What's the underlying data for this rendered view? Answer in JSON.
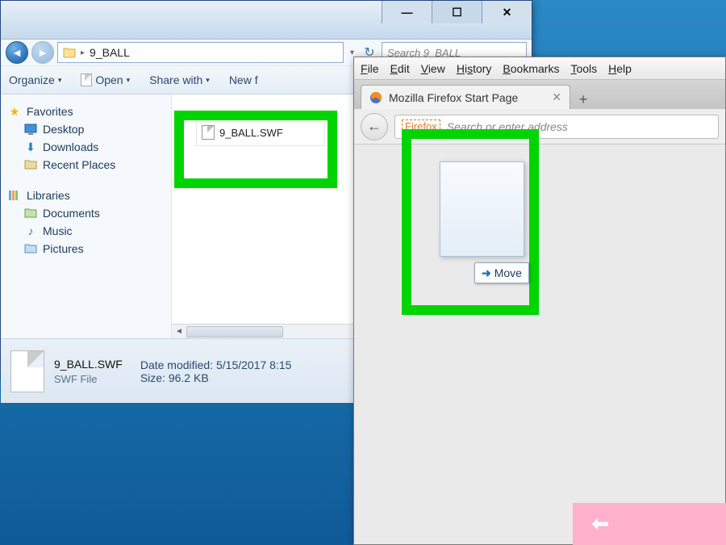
{
  "desktop": {
    "folder_icon": "folder-icon"
  },
  "explorer": {
    "path": "9_BALL",
    "search_placeholder": "Search 9_BALL",
    "toolbar": {
      "organize": "Organize",
      "open": "Open",
      "share": "Share with",
      "newf": "New f"
    },
    "sidebar": {
      "favorites": "Favorites",
      "desktop": "Desktop",
      "downloads": "Downloads",
      "recent": "Recent Places",
      "libraries": "Libraries",
      "documents": "Documents",
      "music": "Music",
      "pictures": "Pictures"
    },
    "file": {
      "name": "9_BALL.SWF"
    },
    "details": {
      "name": "9_BALL.SWF",
      "type": "SWF File",
      "modified_label": "Date modified:",
      "modified": "5/15/2017 8:15",
      "size_label": "Size:",
      "size": "96.2 KB"
    }
  },
  "firefox": {
    "menus": {
      "file": "File",
      "edit": "Edit",
      "view": "View",
      "history": "History",
      "bookmarks": "Bookmarks",
      "tools": "Tools",
      "help": "Help"
    },
    "tab": {
      "title": "Mozilla Firefox Start Page"
    },
    "url": {
      "tag": "Firefox",
      "placeholder": "Search or enter address"
    },
    "drag": {
      "move": "Move"
    }
  }
}
